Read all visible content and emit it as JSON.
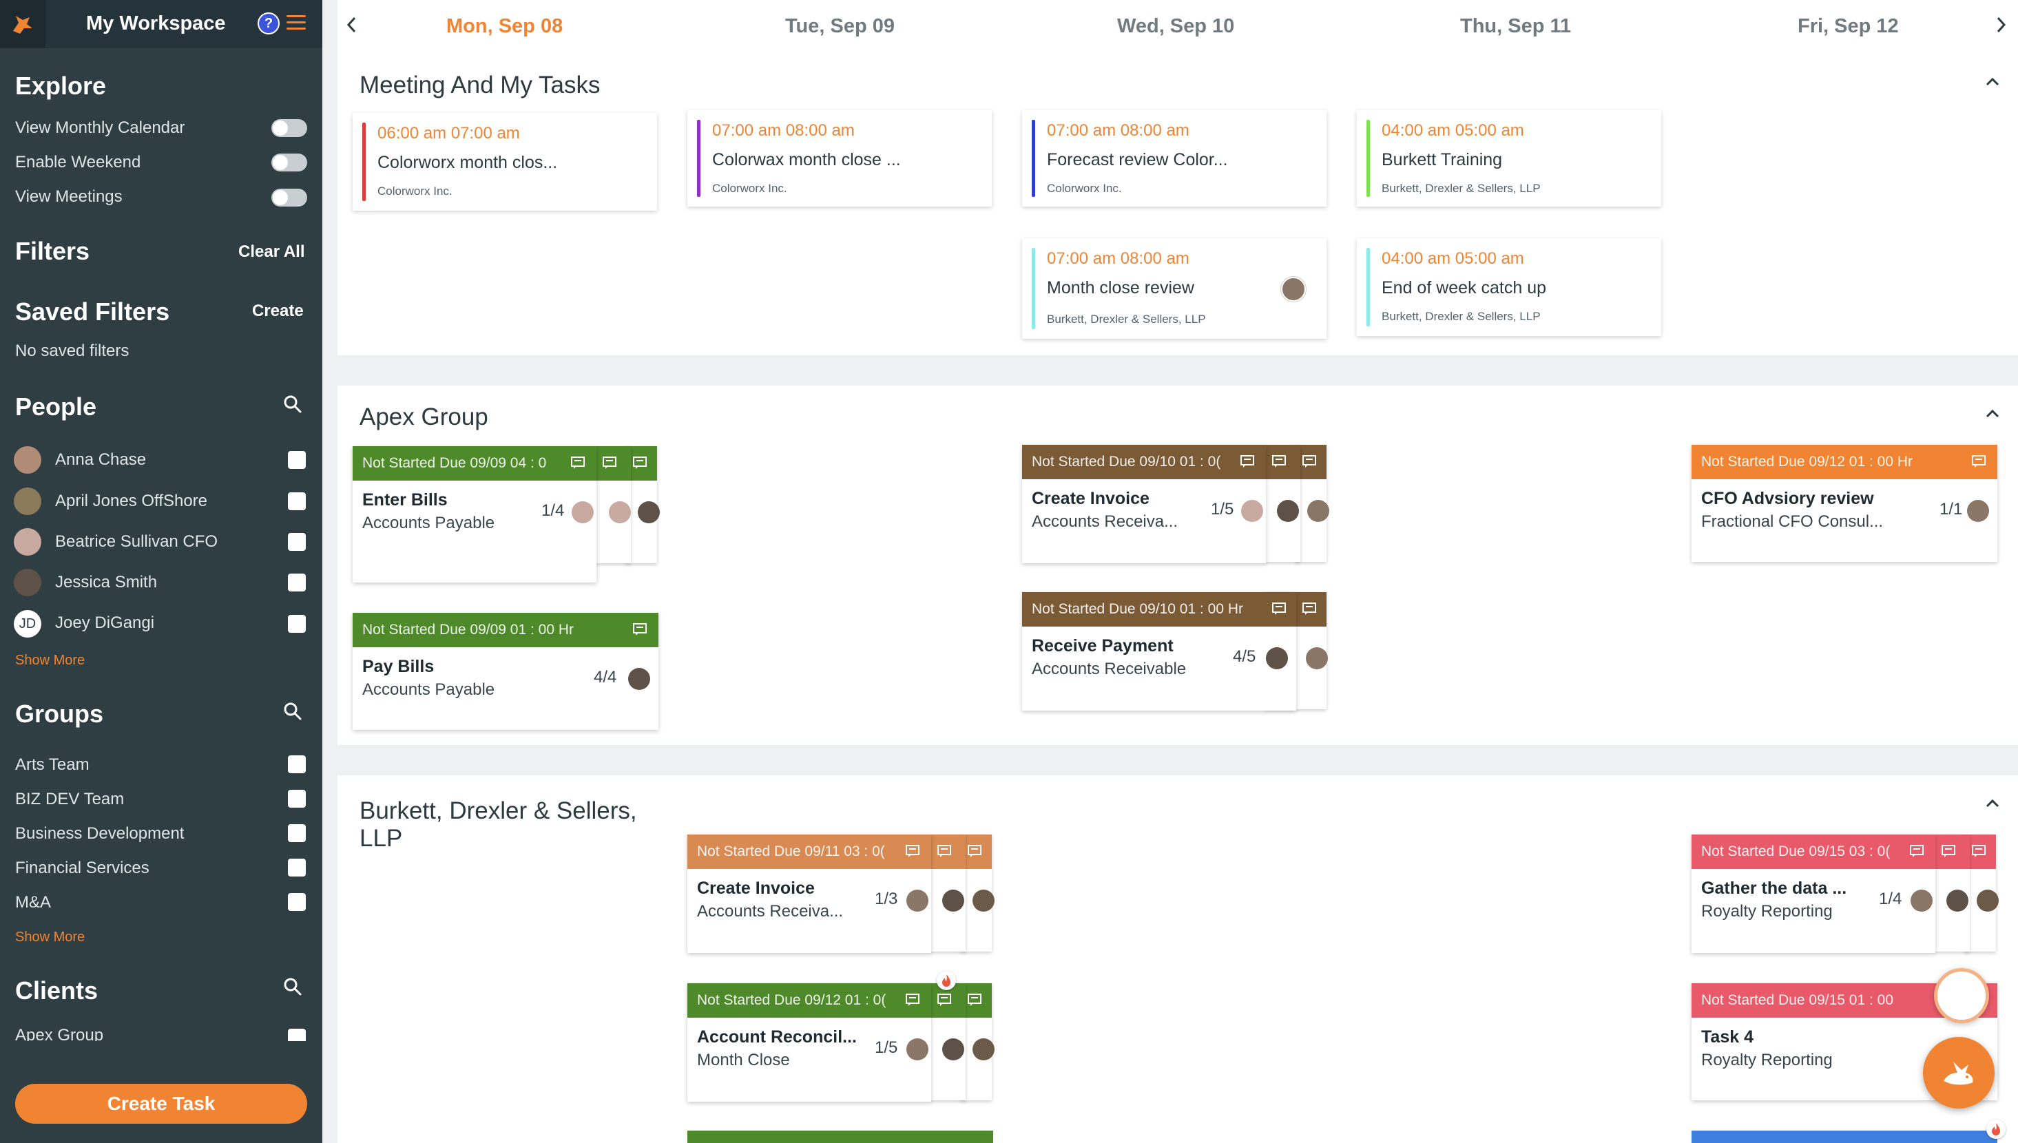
{
  "sidebar": {
    "workspace_title": "My Workspace",
    "help_label": "?",
    "explore": {
      "title": "Explore",
      "items": [
        {
          "label": "View Monthly Calendar",
          "enabled": false
        },
        {
          "label": "Enable Weekend",
          "enabled": false
        },
        {
          "label": "View Meetings",
          "enabled": false
        }
      ]
    },
    "filters": {
      "title": "Filters",
      "clear_label": "Clear All"
    },
    "saved_filters": {
      "title": "Saved Filters",
      "create_label": "Create",
      "empty_text": "No saved filters"
    },
    "people": {
      "title": "People",
      "items": [
        {
          "name": "Anna Chase",
          "initials": ""
        },
        {
          "name": "April Jones OffShore",
          "initials": ""
        },
        {
          "name": "Beatrice Sullivan CFO",
          "initials": ""
        },
        {
          "name": "Jessica Smith",
          "initials": ""
        },
        {
          "name": "Joey DiGangi",
          "initials": "JD"
        }
      ],
      "show_more": "Show More"
    },
    "groups": {
      "title": "Groups",
      "items": [
        "Arts Team",
        "BIZ DEV Team",
        "Business Development",
        "Financial Services",
        "M&A"
      ],
      "show_more": "Show More"
    },
    "clients": {
      "title": "Clients",
      "items": [
        "Apex Group"
      ]
    },
    "create_task_label": "Create Task"
  },
  "calendar": {
    "days": [
      "Mon, Sep 08",
      "Tue, Sep 09",
      "Wed, Sep 10",
      "Thu, Sep 11",
      "Fri, Sep 12"
    ],
    "active_day": "Mon, Sep 08",
    "meetings_section": {
      "title": "Meeting And My Tasks",
      "meetings": [
        {
          "time": "06:00 am 07:00 am",
          "title": "Colorworx month clos...",
          "client": "Colorworx Inc.",
          "color": "#e03b3b"
        },
        {
          "time": "07:00 am 08:00 am",
          "title": "Colorwax month close ...",
          "client": "Colorworx Inc.",
          "color": "#8e2fd0"
        },
        {
          "time": "07:00 am 08:00 am",
          "title": "Forecast review Color...",
          "client": "Colorworx Inc.",
          "color": "#2f3fd6"
        },
        {
          "time": "04:00 am 05:00 am",
          "title": "Burkett Training",
          "client": "Burkett, Drexler & Sellers, LLP",
          "color": "#7fe050"
        },
        {
          "time": "07:00 am 08:00 am",
          "title": "Month close review",
          "client": "Burkett, Drexler & Sellers, LLP",
          "color": "#8ee8e8"
        },
        {
          "time": "04:00 am 05:00 am",
          "title": "End of week catch up",
          "client": "Burkett, Drexler & Sellers, LLP",
          "color": "#8ee8e8"
        }
      ]
    },
    "apex_section": {
      "title": "Apex Group",
      "tasks": [
        {
          "status": "Not Started Due 09/09 04 : 0",
          "name": "Enter Bills",
          "sub": "Accounts Payable",
          "progress": "1/4",
          "color": "#4e8a2a"
        },
        {
          "status": "Not Started    Due 09/09     01 : 00 Hr",
          "name": "Pay Bills",
          "sub": "Accounts Payable",
          "progress": "4/4",
          "color": "#4e8a2a"
        },
        {
          "status": "Not Started Due 09/10 01 : 0(",
          "name": "Create Invoice",
          "sub": "Accounts Receiva...",
          "progress": "1/5",
          "color": "#7b5a36"
        },
        {
          "status": "Not Started Due 09/10 01 : 00 Hr",
          "name": "Receive Payment",
          "sub": "Accounts Receivable",
          "progress": "4/5",
          "color": "#7b5a36"
        },
        {
          "status": "Not Started     Due 09/12     01 : 00 Hr",
          "name": "CFO Advsiory review",
          "sub": "Fractional CFO Consul...",
          "progress": "1/1",
          "color": "#f08432"
        }
      ]
    },
    "burkett_section": {
      "title": "Burkett, Drexler & Sellers, LLP",
      "tasks": [
        {
          "status": "Not Started Due 09/11 03 : 0(",
          "name": "Create Invoice",
          "sub": "Accounts Receiva...",
          "progress": "1/3",
          "color": "#d98a52"
        },
        {
          "status": "Not Started Due 09/12 01 : 0(",
          "name": "Account Reconcil...",
          "sub": "Month Close",
          "progress": "1/5",
          "color": "#4e8a2a"
        },
        {
          "status": "Not Started Due 09/15 03 : 0(",
          "name": "Gather the data ...",
          "sub": "Royalty Reporting",
          "progress": "1/4",
          "color": "#e85a6a"
        },
        {
          "status": "Not Started     Due 09/15     01 : 00",
          "name": "Task 4",
          "sub": "Royalty Reporting",
          "progress": "",
          "color": "#e85a6a"
        }
      ]
    }
  },
  "icons": {
    "logo": "rabbit-logo-icon",
    "search": "search-icon",
    "chat": "chat-icon",
    "fire": "fire-icon",
    "collapse": "chevron-up-icon"
  }
}
